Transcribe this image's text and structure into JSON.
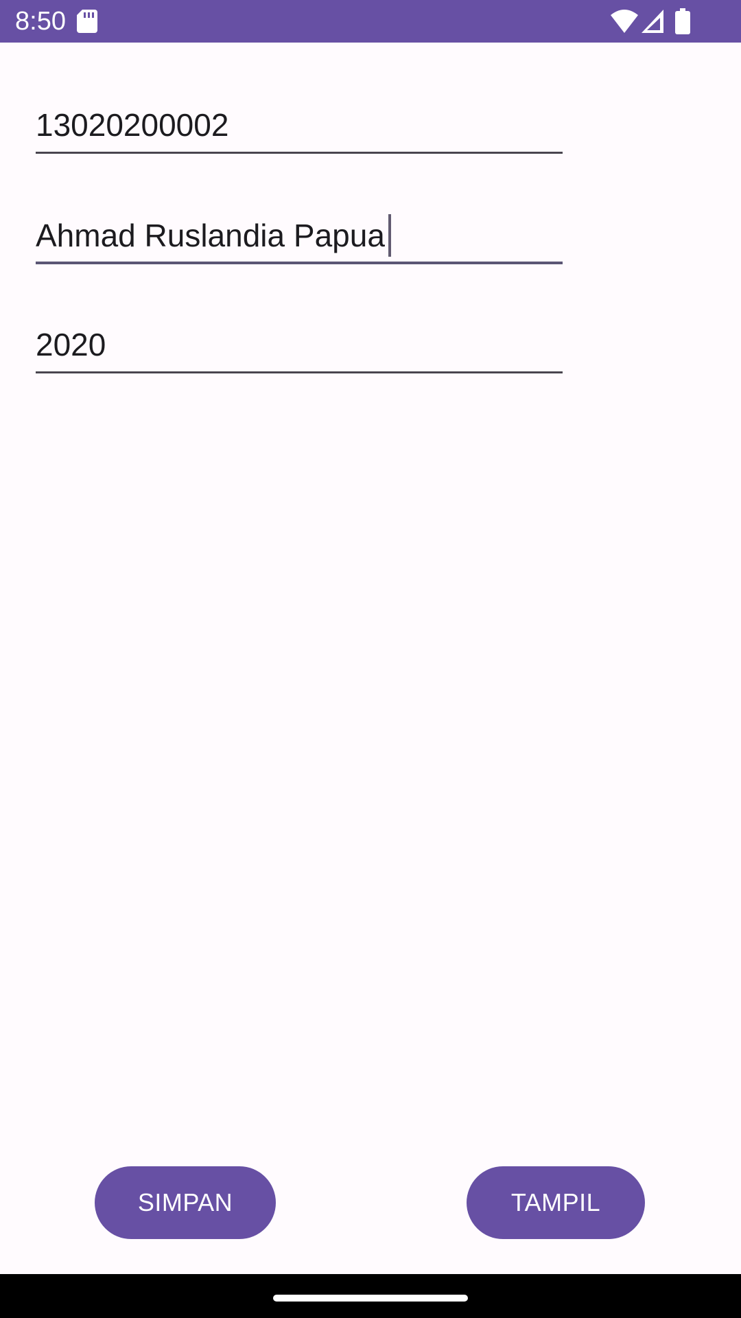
{
  "status_bar": {
    "time": "8:50",
    "icons": [
      "sd-card-icon",
      "wifi-icon",
      "signal-icon",
      "battery-icon"
    ],
    "background_color": "#6750A4"
  },
  "form": {
    "fields": [
      {
        "value": "13020200002"
      },
      {
        "value": "Ahmad Ruslandia Papua",
        "focused": true
      },
      {
        "value": "2020"
      }
    ]
  },
  "buttons": {
    "save_label": "SIMPAN",
    "show_label": "TAMPIL",
    "color": "#6750A4"
  }
}
